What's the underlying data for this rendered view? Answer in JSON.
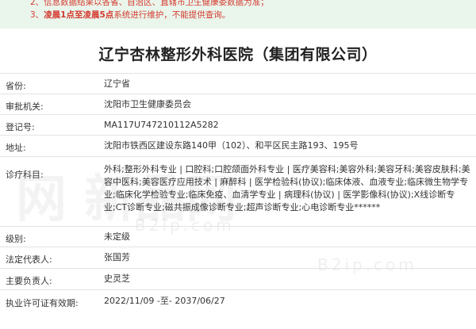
{
  "notice": {
    "line1": "2、信息数据结果以各省、自治区、直辖市卫生健康委数据为准；",
    "line2_prefix": "3、",
    "line2_bold": "凌晨1点至凌晨5点",
    "line2_suffix": "系统进行维护，不能提供查询。"
  },
  "title": "辽宁杏林整形外科医院（集团有限公司）",
  "rows": [
    {
      "label": "省份:",
      "value": "辽宁省"
    },
    {
      "label": "审批机关:",
      "value": "沈阳市卫生健康委员会"
    },
    {
      "label": "登记号:",
      "value": "MA117U747210112A5282"
    },
    {
      "label": "地址:",
      "value": "沈阳市铁西区建设东路140甲（102）、和平区民主路193、195号"
    },
    {
      "label": "诊疗科目:",
      "value": "外科;整形外科专业 | 口腔科;口腔颌面外科专业 | 医疗美容科;美容外科;美容牙科;美容皮肤科;美容中医科;美容医疗应用技术 | 麻醉科 | 医学检验科(协议);临床体液、血液专业;临床微生物学专业;临床化学检验专业;临床免疫、血清学专业 | 病理科(协议) | 医学影像科(协议);X线诊断专业;CT诊断专业;磁共振成像诊断专业;超声诊断专业;心电诊断专业******"
    },
    {
      "label": "级别:",
      "value": "未定级"
    },
    {
      "label": "法定代表人:",
      "value": "张国芳"
    },
    {
      "label": "主要负责人:",
      "value": "史灵芝"
    },
    {
      "label": "执业许可证有效期:",
      "value": "2022/11/09 -至- 2037/06/27"
    }
  ],
  "watermark": {
    "text": "网 新品网",
    "sub": "B2ip.com"
  }
}
